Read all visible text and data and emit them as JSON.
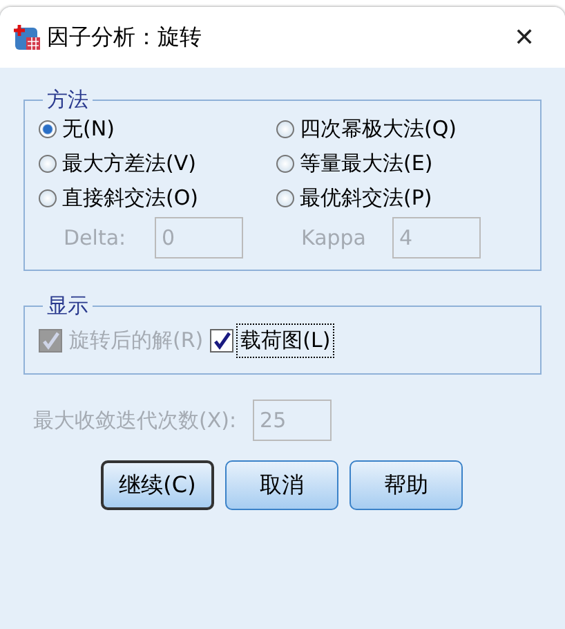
{
  "window": {
    "title": "因子分析：旋转",
    "close": "✕"
  },
  "method": {
    "legend": "方法",
    "options": [
      {
        "label": "无(N)",
        "selected": true
      },
      {
        "label": "四次幂极大法(Q)",
        "selected": false
      },
      {
        "label": "最大方差法(V)",
        "selected": false
      },
      {
        "label": "等量最大法(E)",
        "selected": false
      },
      {
        "label": "直接斜交法(O)",
        "selected": false
      },
      {
        "label": "最优斜交法(P)",
        "selected": false
      }
    ],
    "params": [
      {
        "label": "Delta:",
        "value": "0",
        "disabled": true
      },
      {
        "label": "Kappa",
        "value": "4",
        "disabled": true
      }
    ]
  },
  "display": {
    "legend": "显示",
    "checks": [
      {
        "label": "旋转后的解(R)",
        "checked": true,
        "disabled": true,
        "focused": false
      },
      {
        "label": "载荷图(L)",
        "checked": true,
        "disabled": false,
        "focused": true
      }
    ]
  },
  "iterations": {
    "label": "最大收敛迭代次数(X):",
    "value": "25",
    "disabled": true
  },
  "buttons": [
    {
      "label": "继续(C)",
      "default": true
    },
    {
      "label": "取消",
      "default": false
    },
    {
      "label": "帮助",
      "default": false
    }
  ]
}
